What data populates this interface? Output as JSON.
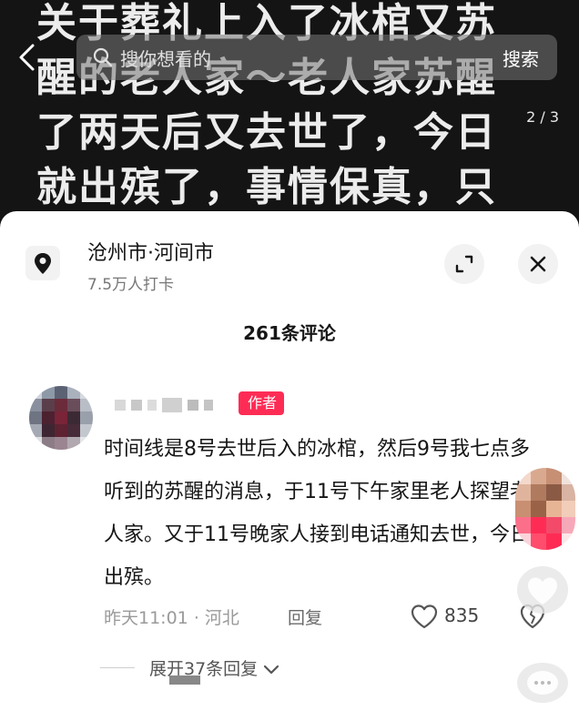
{
  "background": {
    "caption_lines": [
      "关于葬礼上入了冰棺又苏",
      "醒的老人家～老人家苏醒",
      "了两天后又去世了，今日",
      "就出殡了，事情保真，只"
    ]
  },
  "topbar": {
    "search_placeholder": "搜你想看的",
    "search_button": "搜索",
    "page_indicator": "2 / 3"
  },
  "location": {
    "name": "沧州市·河间市",
    "checkins": "7.5万人打卡"
  },
  "comments": {
    "count": "261",
    "count_suffix": "条评论",
    "items": [
      {
        "badge": "作者",
        "text": "时间线是8号去世后入的冰棺，然后9号我七点多听到的苏醒的消息，于11号下午家里老人探望老人家。又于11号晚家人接到电话通知去世，今日出殡。",
        "time": "昨天11:01",
        "region": "河北",
        "reply_label": "回复",
        "likes": "835",
        "expand_label": "展开37条回复"
      }
    ]
  },
  "colors": {
    "accent": "#fe2c55",
    "sheet_bg": "#ffffff",
    "page_bg": "#141414"
  }
}
